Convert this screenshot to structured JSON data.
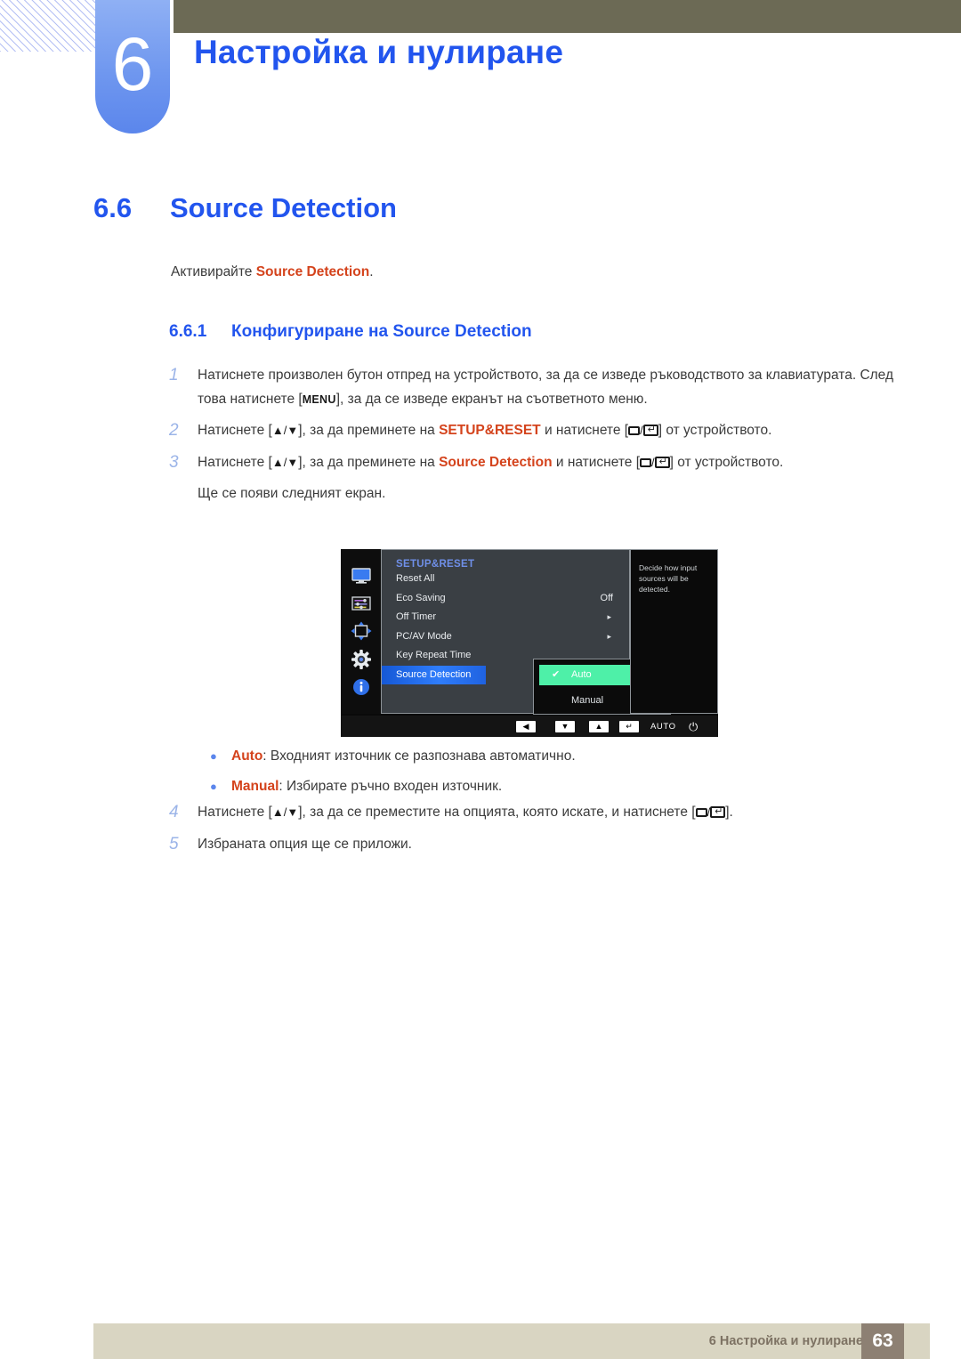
{
  "header": {
    "chapter_number": "6",
    "chapter_title": "Настройка и нулиране",
    "accent_blue": "#2255ee",
    "badge_blue": "#5b86ec",
    "bar_olive": "#6c6a55"
  },
  "section": {
    "number": "6.6",
    "title": "Source Detection",
    "intro_prefix": "Активирайте ",
    "intro_keyword": "Source Detection",
    "intro_suffix": "."
  },
  "subsection": {
    "number": "6.6.1",
    "title": "Конфигуриране на Source Detection"
  },
  "steps": [
    {
      "num": "1",
      "part1": "Натиснете произволен бутон отпред на устройството, за да се изведе ръководството за клавиатурата. След това натиснете [",
      "key": "MENU",
      "part2": "], за да се изведе екранът на съответното меню."
    },
    {
      "num": "2",
      "part1": "Натиснете [",
      "part2": "], за да преминете на ",
      "keyword": "SETUP&RESET",
      "part3": " и натиснете [",
      "part4": "] от устройството."
    },
    {
      "num": "3",
      "part1": "Натиснете [",
      "part2": "], за да преминете на ",
      "keyword": "Source Detection",
      "part3": " и натиснете [",
      "part4": "] от устройството."
    }
  ],
  "after_step3": "Ще се появи следният екран.",
  "osd": {
    "title": "SETUP&RESET",
    "rail_icons": [
      "monitor-icon",
      "sliders-icon",
      "position-arrows-icon",
      "gear-icon",
      "info-icon"
    ],
    "items": [
      {
        "label": "Reset All",
        "value": "",
        "arrow": ""
      },
      {
        "label": "Eco Saving",
        "value": "Off",
        "arrow": ""
      },
      {
        "label": "Off Timer",
        "value": "",
        "arrow": "▸"
      },
      {
        "label": "PC/AV Mode",
        "value": "",
        "arrow": "▸"
      },
      {
        "label": "Key Repeat Time",
        "value": "",
        "arrow": ""
      },
      {
        "label": "Source Detection",
        "value": "",
        "arrow": "",
        "selected": true
      }
    ],
    "submenu": [
      {
        "label": "Auto",
        "checked": true
      },
      {
        "label": "Manual",
        "checked": false
      }
    ],
    "help_text": "Decide how input sources will be detected.",
    "bottom_bar": {
      "left_arrow": "◀",
      "down_arrow": "▼",
      "up_arrow": "▲",
      "enter_arrow": "↵",
      "auto_label": "AUTO",
      "power_icon": "⏻"
    },
    "highlight_color": "#2f7dfb",
    "submenu_highlight_color": "#4ef0a8"
  },
  "bullets": [
    {
      "keyword": "Auto",
      "text": ": Входният източник се разпознава автоматично."
    },
    {
      "keyword": "Manual",
      "text": ": Избирате ръчно входен източник."
    }
  ],
  "steps2": [
    {
      "num": "4",
      "part1": "Натиснете [",
      "part2": "], за да се преместите на опцията, която искате, и натиснете [",
      "part3": "]."
    },
    {
      "num": "5",
      "text": "Избраната опция ще се приложи."
    }
  ],
  "footer": {
    "text": "6 Настройка и нулиране",
    "page": "63"
  }
}
